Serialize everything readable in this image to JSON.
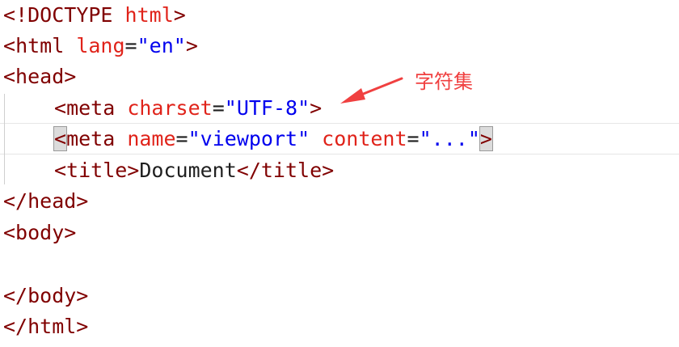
{
  "code": {
    "l1_open": "<",
    "l1_doctype": "!DOCTYPE",
    "l1_html": " html",
    "l1_close": ">",
    "l2_open": "<",
    "l2_tag": "html",
    "l2_attr": " lang",
    "l2_eq": "=",
    "l2_val": "\"en\"",
    "l2_close": ">",
    "l3": "<head>",
    "l4_open": "<",
    "l4_tag": "meta",
    "l4_attr": " charset",
    "l4_eq": "=",
    "l4_val": "\"UTF-8\"",
    "l4_close": ">",
    "l5_open": "<",
    "l5_tag": "meta",
    "l5_attr1": " name",
    "l5_eq1": "=",
    "l5_val1": "\"viewport\"",
    "l5_attr2": " content",
    "l5_eq2": "=",
    "l5_val2": "\"...\"",
    "l5_close": ">",
    "l6_open": "<title>",
    "l6_text": "Document",
    "l6_close": "</title>",
    "l7": "</head>",
    "l8": "<body>",
    "l9": "",
    "l10": "</body>",
    "l11": "</html>"
  },
  "annotation": {
    "label": "字符集",
    "color": "#f04040"
  },
  "colors": {
    "tag": "#800000",
    "attribute": "#e0231a",
    "value": "#0000ee",
    "text": "#1f1f1f"
  }
}
